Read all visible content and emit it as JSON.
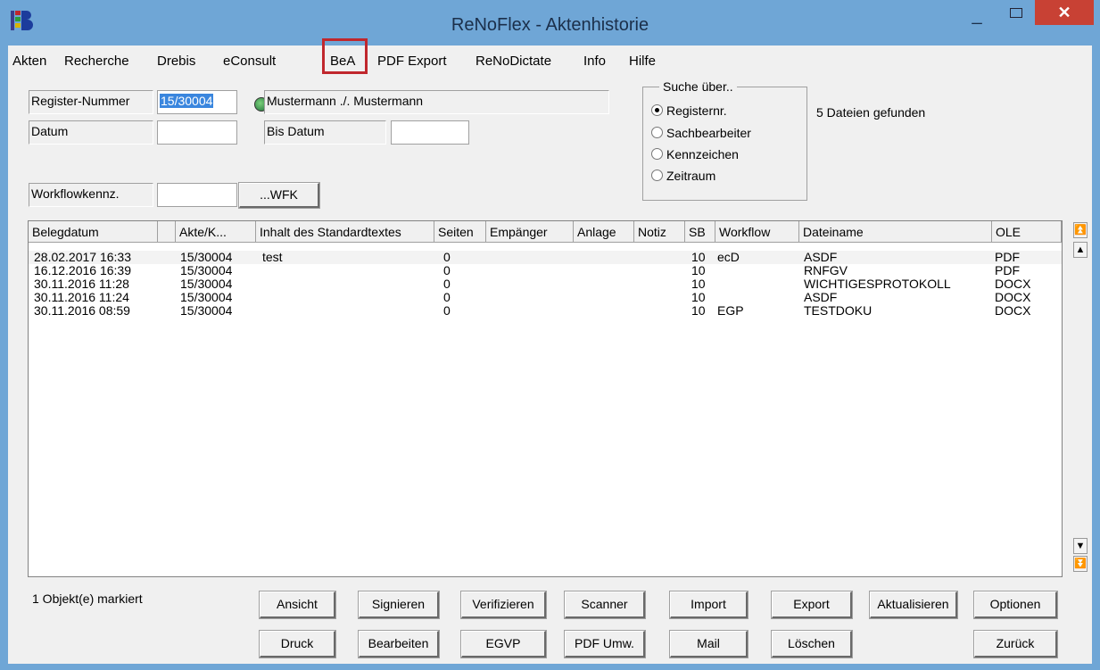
{
  "window": {
    "title": "ReNoFlex - Aktenhistorie",
    "minimize": "_",
    "close": "✕",
    "colors": {
      "titlebar": "#6fa6d6",
      "close": "#c84134",
      "highlight": "#c0272d",
      "selection": "#3a86de"
    }
  },
  "menu": [
    "Akten",
    "Recherche",
    "Drebis",
    "eConsult",
    "BeA",
    "PDF Export",
    "ReNoDictate",
    "Info",
    "Hilfe"
  ],
  "form": {
    "register_label": "Register-Nummer",
    "register_value": "15/30004",
    "parties": "Mustermann ./. Mustermann",
    "datum_label": "Datum",
    "datum_value": "",
    "bis_datum_label": "Bis Datum",
    "bis_datum_value": "",
    "workflow_label": "Workflowkennz.",
    "workflow_value": "",
    "wfk_button": "...WFK"
  },
  "search": {
    "legend": "Suche über..",
    "options": [
      "Registernr.",
      "Sachbearbeiter",
      "Kennzeichen",
      "Zeitraum"
    ],
    "selected": "Registernr.",
    "result": "5 Dateien gefunden"
  },
  "table": {
    "columns": [
      "Belegdatum",
      "",
      "Akte/K...",
      "Inhalt des Standardtextes",
      "Seiten",
      "Empänger",
      "Anlage",
      "Notiz",
      "SB",
      "Workflow",
      "Dateiname",
      "OLE"
    ],
    "rows": [
      [
        "28.02.2017 16:33",
        "15/30004",
        "test",
        "0",
        "10",
        "ecD",
        "ASDF",
        "PDF"
      ],
      [
        "16.12.2016 16:39",
        "15/30004",
        "",
        "0",
        "10",
        "",
        "RNFGV",
        "PDF"
      ],
      [
        "30.11.2016 11:28",
        "15/30004",
        "",
        "0",
        "10",
        "",
        "WICHTIGESPROTOKOLL",
        "DOCX"
      ],
      [
        "30.11.2016 11:24",
        "15/30004",
        "",
        "0",
        "10",
        "",
        "ASDF",
        "DOCX"
      ],
      [
        "30.11.2016 08:59",
        "15/30004",
        "",
        "0",
        "10",
        "EGP",
        "TESTDOKU",
        "DOCX"
      ]
    ]
  },
  "status": "1 Objekt(e) markiert",
  "buttons_row1": [
    "Ansicht",
    "Signieren",
    "Verifizieren",
    "Scanner",
    "Import",
    "Export",
    "Aktualisieren",
    "Optionen"
  ],
  "buttons_row2": [
    "Druck",
    "Bearbeiten",
    "EGVP",
    "PDF Umw.",
    "Mail",
    "Löschen",
    "Zurück"
  ]
}
